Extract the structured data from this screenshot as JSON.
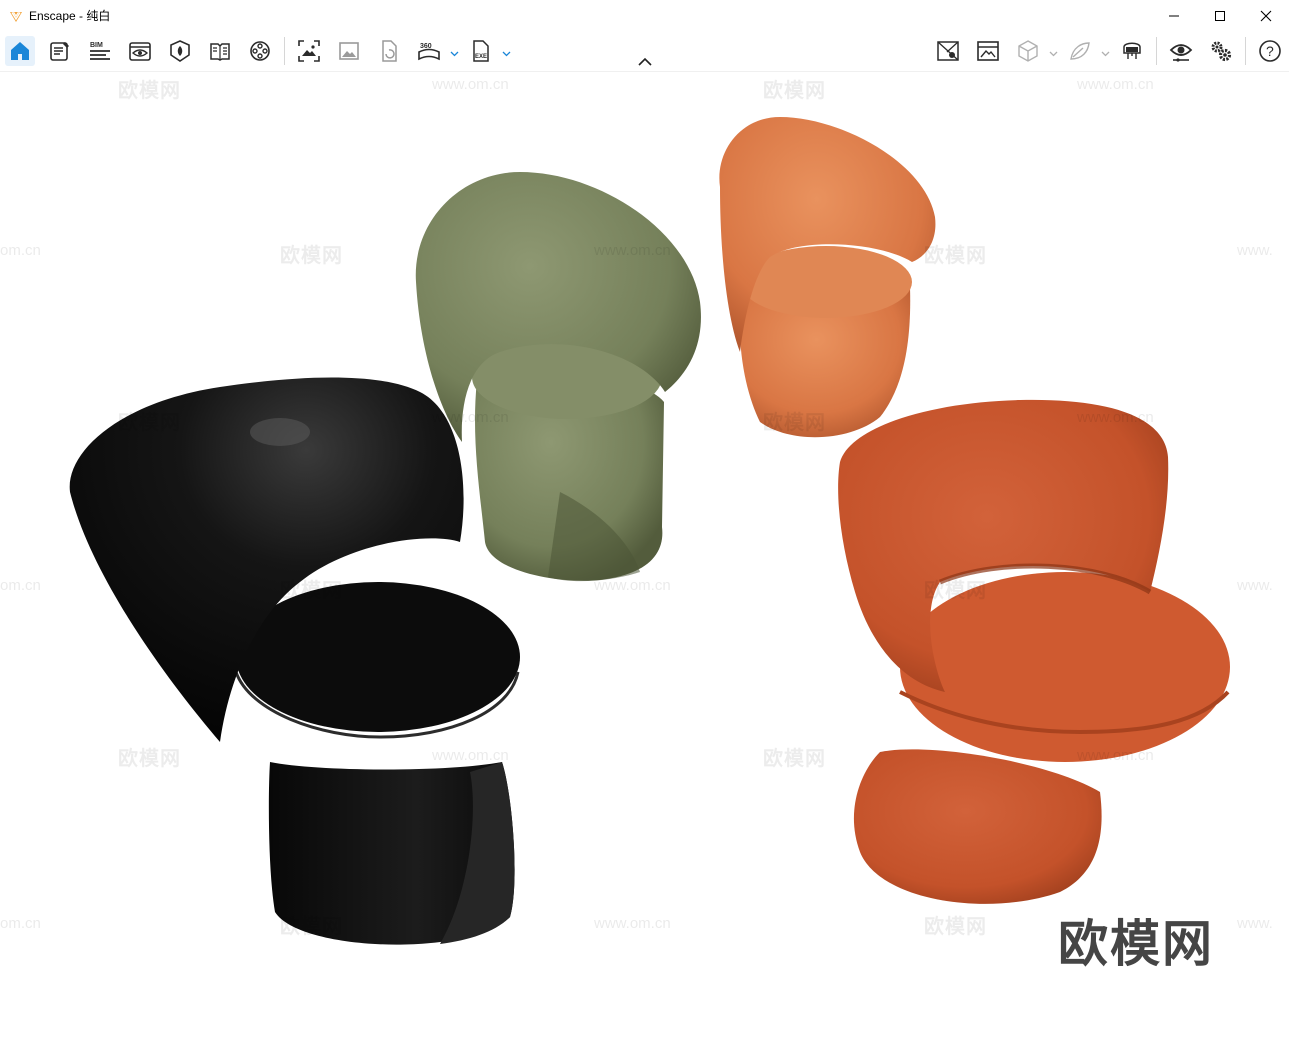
{
  "window": {
    "app_name": "Enscape",
    "separator": " - ",
    "project": "纯白",
    "minimize": "minimize",
    "maximize": "maximize",
    "close": "close"
  },
  "toolbar": {
    "left_icons": [
      "home-icon",
      "edit-sheet-icon",
      "bim-icon",
      "eye-panel-icon",
      "cube-shield-icon",
      "book-icon",
      "film-reel-icon",
      "capture-image-icon",
      "image-icon",
      "file-refresh-icon",
      "panorama-360-icon",
      "exe-export-icon"
    ],
    "right_icons": [
      "map-pin-icon",
      "render-grid-icon",
      "wireframe-cube-icon",
      "leaf-icon",
      "vr-headset-icon",
      "visibility-icon",
      "settings-gears-icon",
      "help-icon"
    ],
    "bim_label": "BIM",
    "pano_label": "360",
    "exe_label": "EXE",
    "help_label": "?"
  },
  "scene": {
    "objects": [
      {
        "name": "black-chair",
        "color": "#0f0f0f"
      },
      {
        "name": "green-chair",
        "color": "#7b8560"
      },
      {
        "name": "peach-chair",
        "color": "#dc7a49"
      },
      {
        "name": "rust-chair",
        "color": "#c4522a"
      }
    ],
    "watermark_text": "欧模网",
    "watermark_url": "www.om.cn",
    "watermark_partial": "om.cn",
    "watermark_partial_www": "www."
  },
  "colors": {
    "accent": "#1a86d8",
    "icon": "#2b2b2b",
    "logo": "#f2a33a"
  }
}
